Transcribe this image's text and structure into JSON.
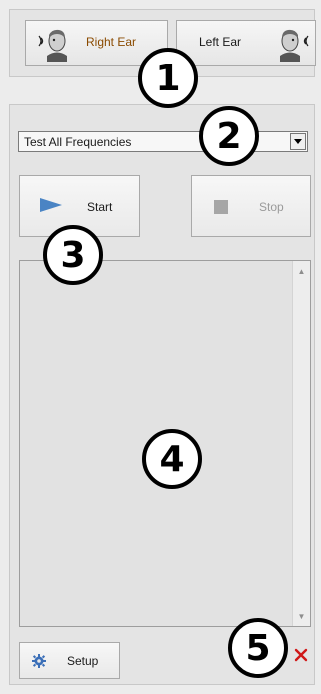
{
  "ear_selector": {
    "right_label": "Right Ear",
    "left_label": "Left Ear",
    "right_label_color": "#8a4a00",
    "left_label_color": "#1a1a1a"
  },
  "test_mode": {
    "selected": "Test All Frequencies"
  },
  "controls": {
    "start_label": "Start",
    "stop_label": "Stop",
    "start_icon": "play-triangle",
    "stop_icon": "stop-square",
    "accent": "#4a84c4"
  },
  "setup": {
    "label": "Setup"
  },
  "callouts": [
    "1",
    "2",
    "3",
    "4",
    "5"
  ]
}
